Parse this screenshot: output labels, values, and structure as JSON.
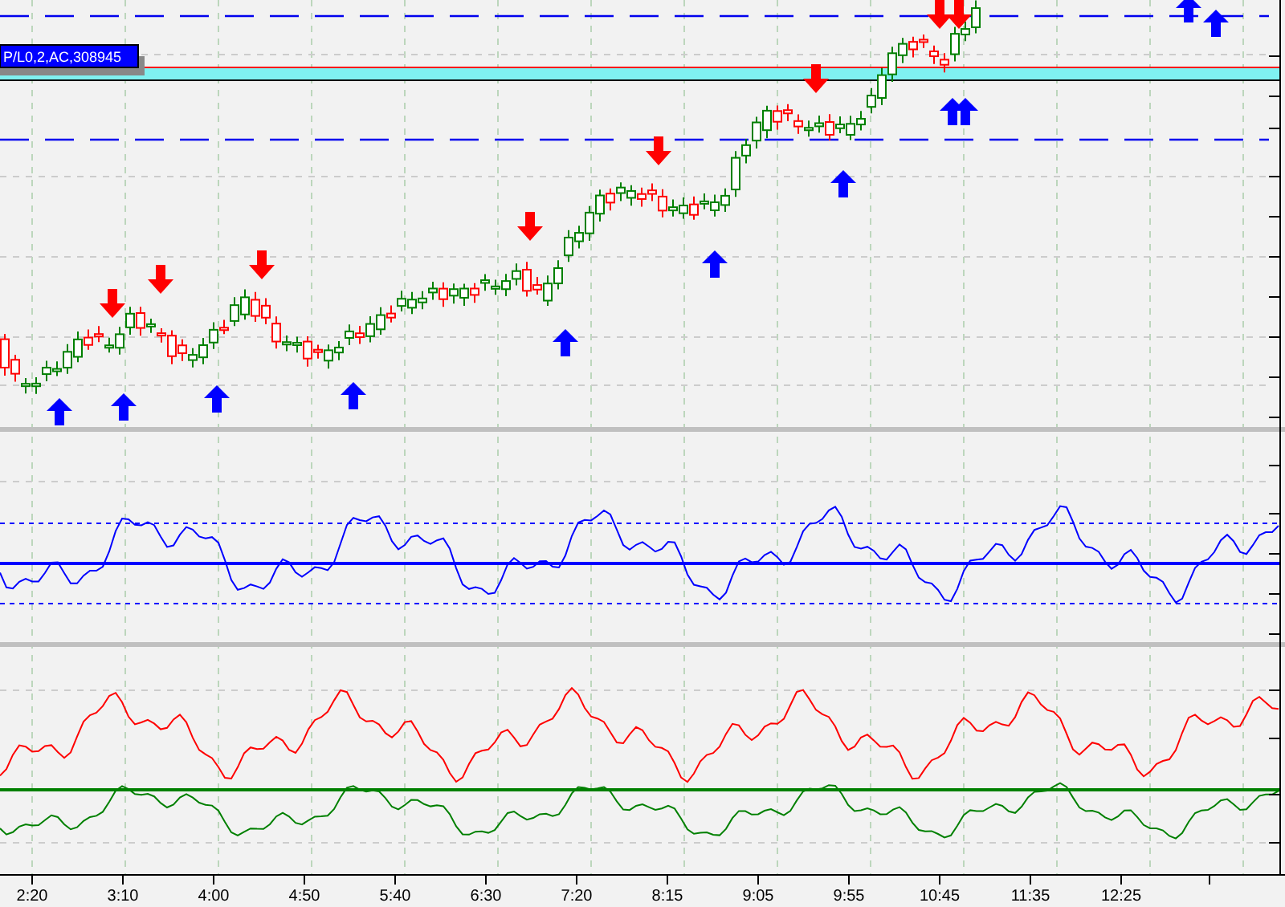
{
  "price_panel": {
    "position_label": "P/L0,2,AC,308945"
  },
  "time_axis": {
    "labels": [
      "2:20",
      "3:10",
      "4:00",
      "4:50",
      "5:40",
      "6:30",
      "7:20",
      "8:15",
      "9:05",
      "9:55",
      "10:45",
      "11:35",
      "12:25"
    ]
  }
}
